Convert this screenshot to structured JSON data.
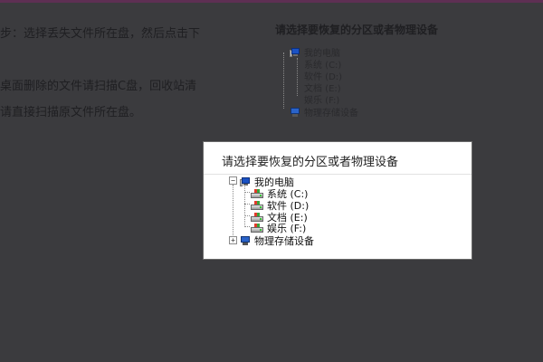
{
  "background": {
    "text_lines": [
      "步：选择丢失文件所在盘，然后点击下",
      "桌面删除的文件请扫描C盘，回收站清",
      "请直接扫描原文件所在盘。"
    ],
    "panel_title": "请选择要恢复的分区或者物理设备",
    "tree": {
      "root": "我的电脑",
      "drives": [
        "系统 (C:)",
        "软件 (D:)",
        "文档 (E:)",
        "娱乐 (F:)"
      ],
      "device": "物理存储设备"
    }
  },
  "dialog": {
    "title": "请选择要恢复的分区或者物理设备",
    "tree": {
      "root": {
        "label": "我的电脑",
        "toggle": "−"
      },
      "drives": [
        {
          "label": "系统 (C:)"
        },
        {
          "label": "软件 (D:)"
        },
        {
          "label": "文档 (E:)"
        },
        {
          "label": "娱乐 (F:)"
        }
      ],
      "device": {
        "label": "物理存储设备",
        "toggle": "+"
      }
    }
  },
  "colors": {
    "overlay": "#3b3b3e",
    "top_bar": "#5e2f53",
    "dialog_bg": "#ffffff"
  }
}
